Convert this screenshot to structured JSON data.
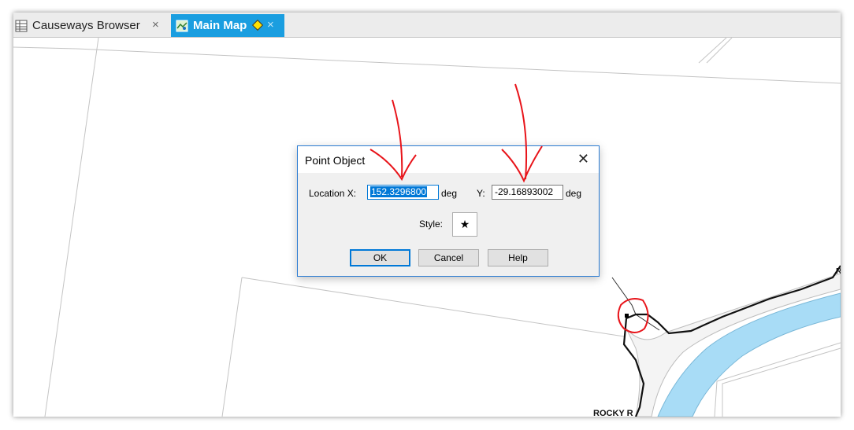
{
  "tabs": [
    {
      "label": "Causeways Browser",
      "icon": "table-icon",
      "close": "×",
      "active": false
    },
    {
      "label": "Main Map",
      "icon": "map-icon",
      "close": "×",
      "active": true
    }
  ],
  "colors": {
    "tab_active": "#1a9ee0",
    "river": "#a8dcf6",
    "annotation": "#e8141a",
    "dialog_accent": "#0078d7"
  },
  "map": {
    "road_label": "ROCKY R"
  },
  "dialog": {
    "title": "Point Object",
    "close": "✕",
    "location_x_label": "Location X:",
    "x_value": "152.3296800",
    "x_unit": "deg",
    "y_label": "Y:",
    "y_value": "-29.16893002",
    "y_unit": "deg",
    "style_label": "Style:",
    "style_symbol": "★",
    "buttons": {
      "ok": "OK",
      "cancel": "Cancel",
      "help": "Help"
    }
  }
}
